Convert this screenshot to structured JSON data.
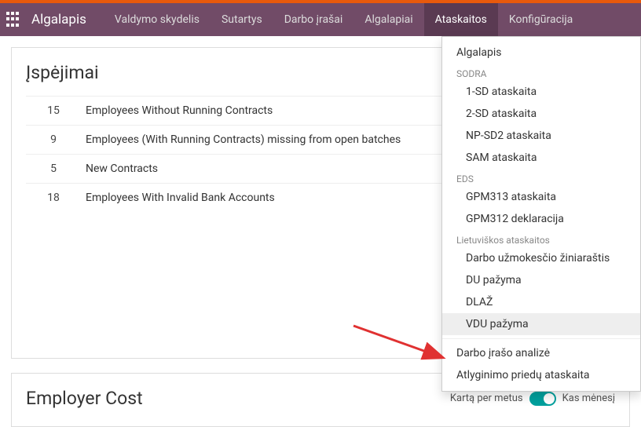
{
  "brand": "Algalapis",
  "nav": {
    "items": [
      {
        "label": "Valdymo skydelis"
      },
      {
        "label": "Sutartys"
      },
      {
        "label": "Darbo įrašai"
      },
      {
        "label": "Algalapiai"
      },
      {
        "label": "Ataskaitos",
        "active": true
      },
      {
        "label": "Konfigūracija"
      }
    ]
  },
  "warnings": {
    "title": "Įspėjimai",
    "rows": [
      {
        "count": "15",
        "text": "Employees Without Running Contracts"
      },
      {
        "count": "9",
        "text": "Employees (With Running Contracts) missing from open batches"
      },
      {
        "count": "5",
        "text": "New Contracts"
      },
      {
        "count": "18",
        "text": "Employees With Invalid Bank Accounts"
      }
    ]
  },
  "employer": {
    "title": "Employer Cost",
    "toggle_left": "Kartą per metus",
    "toggle_right": "Kas mėnesį"
  },
  "dropdown": {
    "top_item": "Algalapis",
    "groups": [
      {
        "header": "SODRA",
        "items": [
          "1-SD ataskaita",
          "2-SD ataskaita",
          "NP-SD2 ataskaita",
          "SAM ataskaita"
        ]
      },
      {
        "header": "EDS",
        "items": [
          "GPM313 ataskaita",
          "GPM312 deklaracija"
        ]
      },
      {
        "header": "Lietuviškos ataskaitos",
        "items": [
          "Darbo užmokesčio žiniaraštis",
          "DU pažyma",
          "DLAŽ",
          "VDU pažyma"
        ]
      }
    ],
    "highlighted": "VDU pažyma",
    "bottom_items": [
      "Darbo įrašo analizė",
      "Atlyginimo priedų ataskaita"
    ]
  }
}
